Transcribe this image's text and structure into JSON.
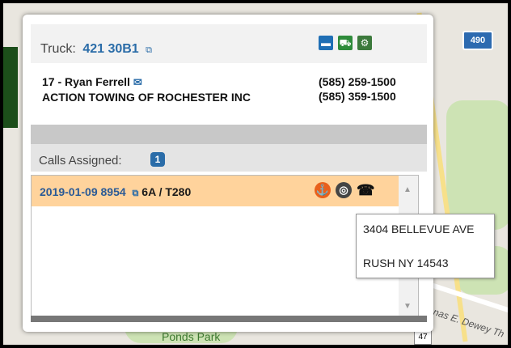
{
  "map": {
    "interstate_label": "490",
    "route_label": "47",
    "park_label": "Ponds Park",
    "road_label": "nas E. Dewey Th"
  },
  "header": {
    "truck_label": "Truck:",
    "truck_id": "421 30B1",
    "icons": [
      "battery-icon",
      "tow-truck-icon",
      "wrecker-icon"
    ]
  },
  "driver": {
    "name": "17 - Ryan Ferrell",
    "company": "ACTION TOWING OF ROCHESTER INC",
    "phone1": "(585) 259-1500",
    "phone2": "(585) 359-1500"
  },
  "calls": {
    "label": "Calls Assigned:",
    "count": "1",
    "items": [
      {
        "call_number": "2019-01-09 8954",
        "zone": "6A / T280"
      }
    ]
  },
  "tooltip": {
    "line1": "3404 BELLEVUE AVE",
    "line2": "RUSH NY 14543"
  },
  "colors": {
    "accent": "#2a6ca8",
    "row_highlight": "#ffd39c"
  }
}
